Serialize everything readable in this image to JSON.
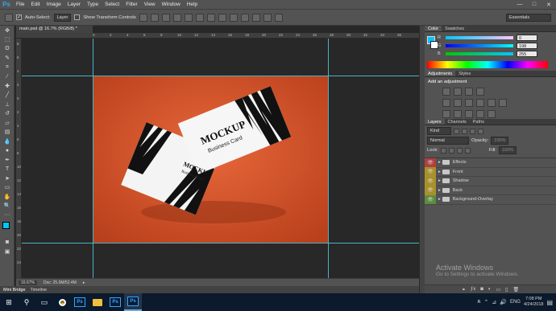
{
  "app": {
    "logo": "Ps"
  },
  "menu": [
    "File",
    "Edit",
    "Image",
    "Layer",
    "Type",
    "Select",
    "Filter",
    "View",
    "Window",
    "Help"
  ],
  "window_controls": {
    "minimize": "—",
    "maximize": "□",
    "close": "✕"
  },
  "options": {
    "auto_select_label": "Auto-Select:",
    "auto_select_value": "Layer",
    "show_transform_label": "Show Transform Controls",
    "workspace": "Essentials"
  },
  "tools": [
    "move",
    "marquee",
    "lasso",
    "quick-select",
    "crop",
    "eyedropper",
    "healing",
    "brush",
    "clone",
    "history-brush",
    "eraser",
    "gradient",
    "blur",
    "dodge",
    "pen",
    "type",
    "path-select",
    "shape",
    "hand",
    "zoom",
    "more"
  ],
  "document": {
    "tab_title": "main.psd @ 16.7% (RGB/8) *",
    "ruler_top": [
      "0",
      "2",
      "4",
      "6",
      "8",
      "10",
      "12",
      "14",
      "16",
      "18",
      "20",
      "22",
      "24",
      "26",
      "28",
      "30",
      "32",
      "34",
      "36"
    ],
    "ruler_left": [
      "8",
      "6",
      "4",
      "2",
      "0",
      "2",
      "4",
      "6",
      "8",
      "10",
      "12",
      "14",
      "16",
      "18",
      "20",
      "22",
      "24"
    ],
    "card_front": {
      "title": "MOCKUP",
      "subtitle": "Business Card"
    },
    "card_back": {
      "title": "MOCKUP",
      "subtitle": "Business Card"
    },
    "zoom": "16.67%",
    "doc_size": "Doc: 25.0M/52.4M"
  },
  "bottom_tabs": [
    "Mini Bridge",
    "Timeline"
  ],
  "color_panel": {
    "tabs": [
      "Color",
      "Swatches"
    ],
    "r": {
      "label": "R",
      "value": "0"
    },
    "g": {
      "label": "G",
      "value": "198"
    },
    "b": {
      "label": "B",
      "value": "255"
    },
    "fg_color": "#00c6ff"
  },
  "adjustments_panel": {
    "tabs": [
      "Adjustments",
      "Styles"
    ],
    "heading": "Add an adjustment"
  },
  "layers_panel": {
    "tabs": [
      "Layers",
      "Channels",
      "Paths"
    ],
    "kind_label": "Kind",
    "blend_mode": "Normal",
    "opacity_label": "Opacity:",
    "opacity_value": "100%",
    "lock_label": "Lock:",
    "fill_label": "Fill:",
    "fill_value": "100%",
    "layers": [
      {
        "name": "Effects",
        "color": "#b04040"
      },
      {
        "name": "Front",
        "color": "#a8902a"
      },
      {
        "name": "Shadow",
        "color": "#a8902a"
      },
      {
        "name": "Back",
        "color": "#a8902a"
      },
      {
        "name": "Background-Overlay",
        "color": "#5c8c3c"
      }
    ]
  },
  "watermark": {
    "title": "Activate Windows",
    "subtitle": "Go to Settings to activate Windows."
  },
  "taskbar": {
    "time": "7:08 PM",
    "date": "4/24/2018",
    "lang": "ENG",
    "ps_label": "Ps"
  }
}
